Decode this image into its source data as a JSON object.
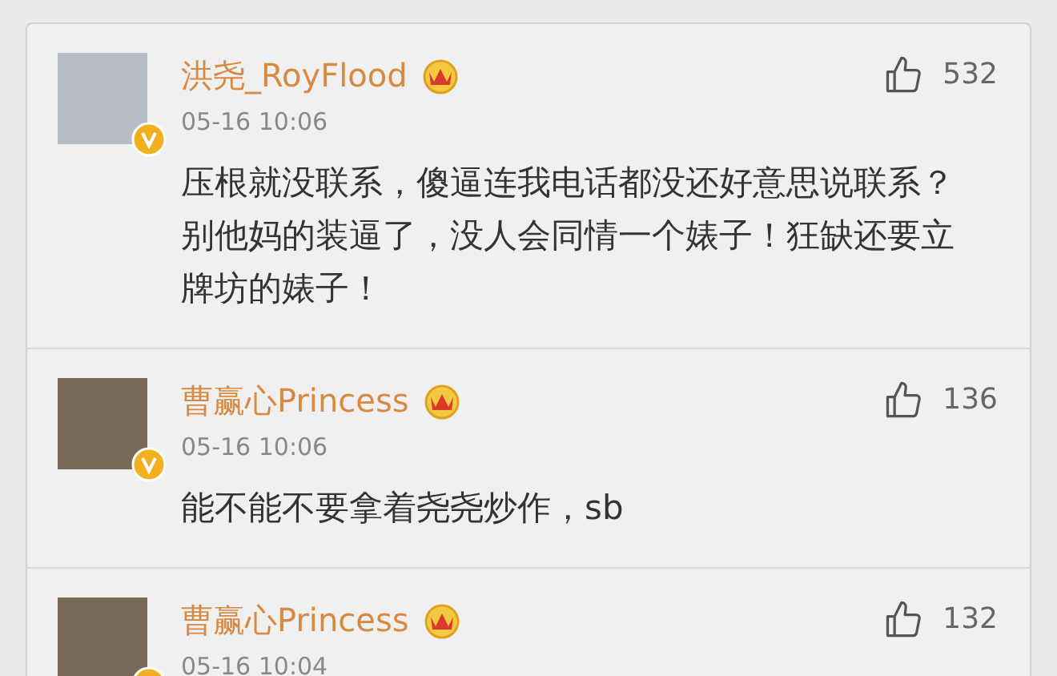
{
  "comments": [
    {
      "name": "洪尧_RoyFlood",
      "time": "05-16 10:06",
      "likes": "532",
      "verified": true,
      "text": "压根就没联系，傻逼连我电话都没还好意思说联系？别他妈的装逼了，没人会同情一个婊子！狂缺还要立牌坊的婊子！"
    },
    {
      "name": "曹赢心Princess",
      "time": "05-16 10:06",
      "likes": "136",
      "verified": true,
      "text": "能不能不要拿着尧尧炒作，sb"
    },
    {
      "name": "曹赢心Princess",
      "time": "05-16 10:04",
      "likes": "132",
      "verified": true
    }
  ]
}
